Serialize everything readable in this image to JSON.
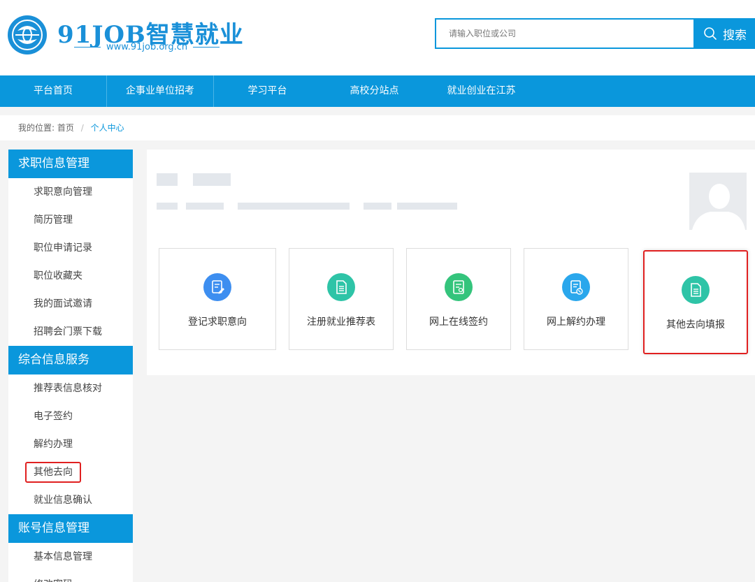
{
  "brand": {
    "name": "91JOB智慧就业",
    "url": "www.91job.org.cn",
    "color": "#1a90d8"
  },
  "search": {
    "placeholder": "请输入职位或公司",
    "button_label": "搜索"
  },
  "nav": {
    "items": [
      "平台首页",
      "企事业单位招考",
      "学习平台",
      "高校分站点",
      "就业创业在江苏"
    ]
  },
  "breadcrumb": {
    "prefix": "我的位置:",
    "home": "首页",
    "separator": "/",
    "current": "个人中心"
  },
  "sidebar": {
    "sections": [
      {
        "title": "求职信息管理",
        "items": [
          "求职意向管理",
          "简历管理",
          "职位申请记录",
          "职位收藏夹",
          "我的面试邀请",
          "招聘会门票下载"
        ]
      },
      {
        "title": "综合信息服务",
        "items": [
          "推荐表信息核对",
          "电子签约",
          "解约办理",
          "其他去向",
          "就业信息确认"
        ]
      },
      {
        "title": "账号信息管理",
        "items": [
          "基本信息管理",
          "修改密码"
        ]
      }
    ],
    "highlighted_item": "其他去向"
  },
  "cards": [
    {
      "label": "登记求职意向",
      "icon": "edit-form-icon",
      "color": "#3d8ef0"
    },
    {
      "label": "注册就业推荐表",
      "icon": "document-icon",
      "color": "#2ec4a7"
    },
    {
      "label": "网上在线签约",
      "icon": "contract-sign-icon",
      "color": "#34c47c"
    },
    {
      "label": "网上解约办理",
      "icon": "cancel-contract-icon",
      "color": "#2aa7ec"
    },
    {
      "label": "其他去向填报",
      "icon": "document-icon",
      "color": "#2ec4a7"
    }
  ],
  "colors": {
    "primary": "#0a97dc",
    "highlight": "#e02020"
  }
}
